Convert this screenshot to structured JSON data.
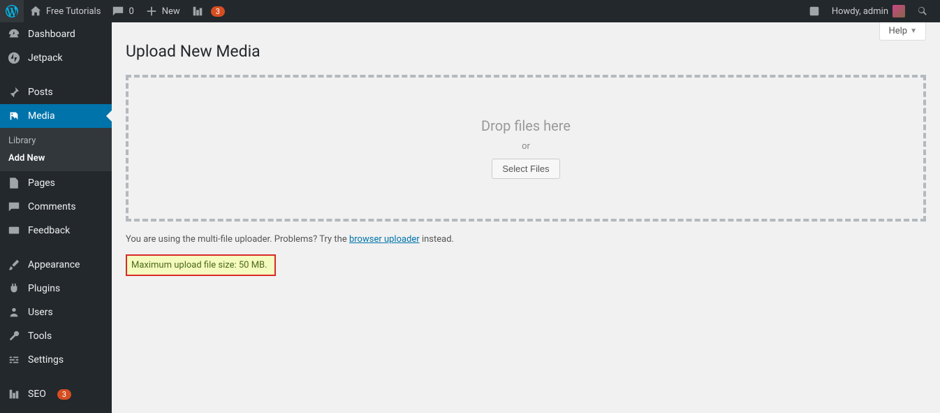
{
  "adminbar": {
    "site_name": "Free Tutorials",
    "comments_count": "0",
    "new_label": "New",
    "badge_count": "3",
    "howdy": "Howdy, admin"
  },
  "sidebar": {
    "items": [
      {
        "label": "Dashboard",
        "icon": "dashboard"
      },
      {
        "label": "Jetpack",
        "icon": "jetpack"
      },
      {
        "label": "Posts",
        "icon": "pin"
      },
      {
        "label": "Media",
        "icon": "media",
        "current": true
      },
      {
        "label": "Pages",
        "icon": "page"
      },
      {
        "label": "Comments",
        "icon": "comment"
      },
      {
        "label": "Feedback",
        "icon": "feedback"
      },
      {
        "label": "Appearance",
        "icon": "appearance"
      },
      {
        "label": "Plugins",
        "icon": "plugin"
      },
      {
        "label": "Users",
        "icon": "users"
      },
      {
        "label": "Tools",
        "icon": "tools"
      },
      {
        "label": "Settings",
        "icon": "settings"
      },
      {
        "label": "SEO",
        "icon": "seo",
        "badge": "3"
      }
    ],
    "submenu": {
      "library": "Library",
      "add_new": "Add New"
    }
  },
  "page": {
    "help": "Help",
    "title": "Upload New Media",
    "drop_text": "Drop files here",
    "or_text": "or",
    "select_files": "Select Files",
    "uploader_info_pre": "You are using the multi-file uploader. Problems? Try the ",
    "uploader_link": "browser uploader",
    "uploader_info_post": " instead.",
    "max_upload": "Maximum upload file size: 50 MB."
  }
}
